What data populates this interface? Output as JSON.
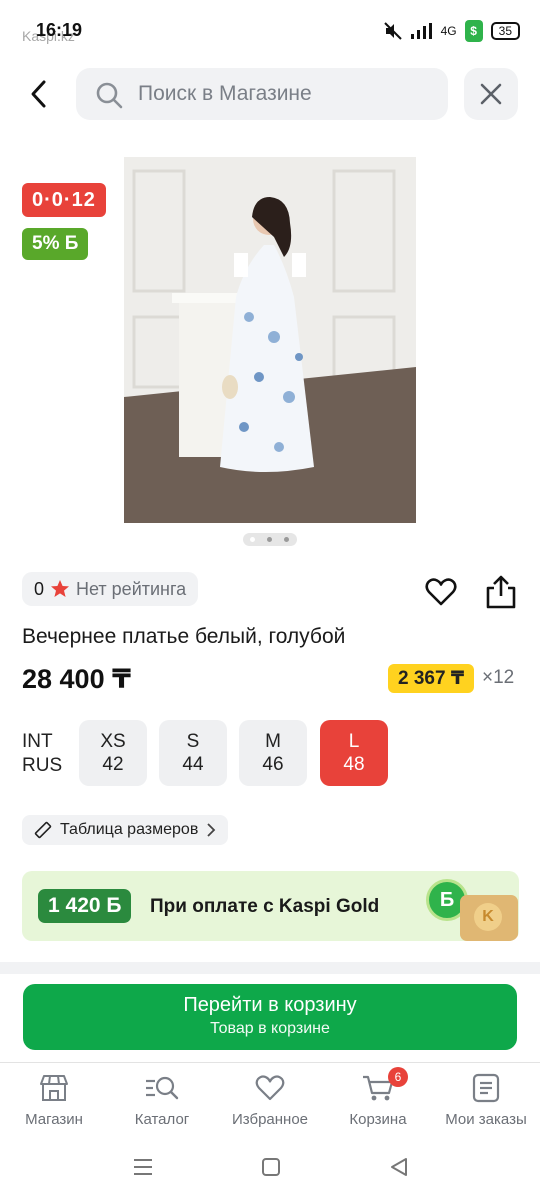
{
  "status_bar": {
    "time": "16:19",
    "app_name": "Kaspi.kz",
    "network": "4G",
    "battery": "35"
  },
  "search": {
    "placeholder": "Поиск в Магазине"
  },
  "product": {
    "timer_badge": "0·0·12",
    "bonus_badge": "5% Б",
    "image_pages": 3,
    "image_current_page": 1,
    "rating_count": "0",
    "rating_text": "Нет рейтинга",
    "title": "Вечернее платье белый, голубой",
    "price": "28 400 ₸",
    "monthly_payment": "2 367 ₸",
    "installment_months": "×12"
  },
  "sizes": {
    "label_int": "INT",
    "label_rus": "RUS",
    "options": [
      {
        "int": "XS",
        "rus": "42",
        "selected": false
      },
      {
        "int": "S",
        "rus": "44",
        "selected": false
      },
      {
        "int": "M",
        "rus": "46",
        "selected": false
      },
      {
        "int": "L",
        "rus": "48",
        "selected": true
      }
    ],
    "size_table_label": "Таблица размеров"
  },
  "kaspi_gold": {
    "amount": "1 420 Б",
    "text": "При оплате с Kaspi Gold"
  },
  "cart_button": {
    "title": "Перейти в корзину",
    "subtitle": "Товар в корзине"
  },
  "tabbar": {
    "items": [
      {
        "label": "Магазин",
        "icon": "shop-icon"
      },
      {
        "label": "Каталог",
        "icon": "catalog-search-icon"
      },
      {
        "label": "Избранное",
        "icon": "heart-icon"
      },
      {
        "label": "Корзина",
        "icon": "cart-icon"
      },
      {
        "label": "Мои заказы",
        "icon": "orders-icon"
      }
    ],
    "cart_count": "6"
  },
  "colors": {
    "primary_green": "#0ea84a",
    "accent_red": "#e8423a",
    "bonus_green": "#59a82a",
    "credit_yellow": "#ffd21f"
  }
}
